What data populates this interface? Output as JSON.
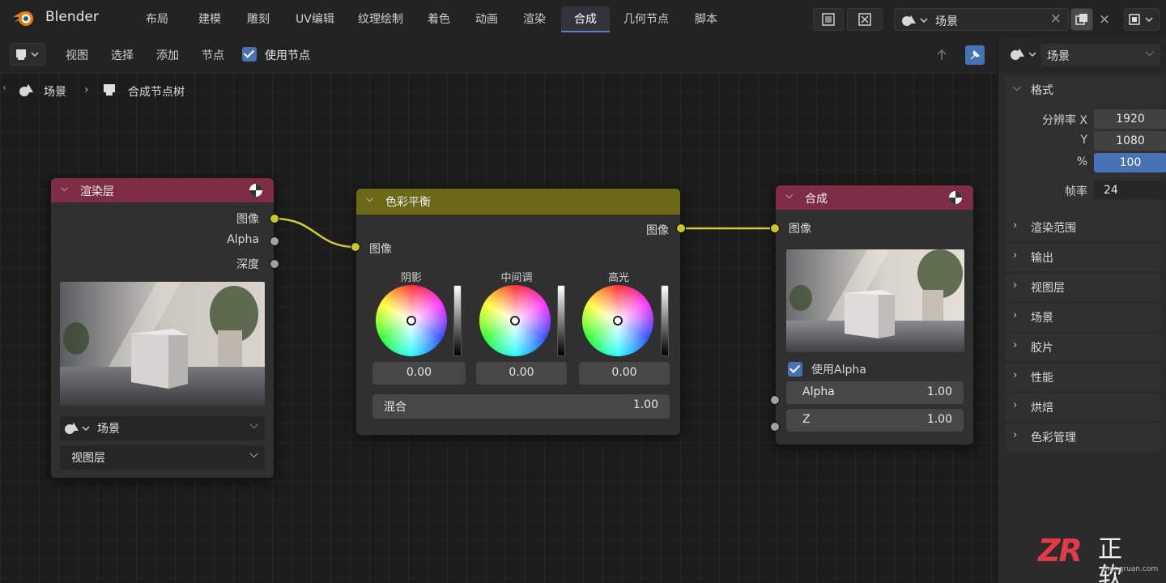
{
  "app": {
    "name": "Blender"
  },
  "workspaces": [
    "布局",
    "建模",
    "雕刻",
    "UV编辑",
    "纹理绘制",
    "着色",
    "动画",
    "渲染",
    "合成",
    "几何节点",
    "脚本"
  ],
  "active_workspace": "合成",
  "topbar": {
    "scene_name": "场景",
    "close_symbol": "×"
  },
  "editor_header": {
    "menus": [
      "视图",
      "选择",
      "添加",
      "节点"
    ],
    "use_nodes_label": "使用节点"
  },
  "breadcrumb": {
    "scene": "场景",
    "tree": "合成节点树"
  },
  "render_layers_node": {
    "title": "渲染层",
    "outputs": [
      "图像",
      "Alpha",
      "深度"
    ],
    "scene": "场景",
    "view_layer": "视图层"
  },
  "color_balance_node": {
    "title": "色彩平衡",
    "output": "图像",
    "input": "图像",
    "wheels": [
      {
        "label": "阴影",
        "value": "0.00"
      },
      {
        "label": "中间调",
        "value": "0.00"
      },
      {
        "label": "高光",
        "value": "0.00"
      }
    ],
    "mix_label": "混合",
    "mix_value": "1.00"
  },
  "composite_node": {
    "title": "合成",
    "input": "图像",
    "use_alpha_label": "使用Alpha",
    "alpha_label": "Alpha",
    "alpha_value": "1.00",
    "z_label": "Z",
    "z_value": "1.00"
  },
  "sidebar": {
    "scene_name": "场景",
    "format": {
      "title": "格式",
      "res_x_label": "分辨率 X",
      "res_x": "1920",
      "res_y_label": "Y",
      "res_y": "1080",
      "percent_label": "%",
      "percent": "100",
      "fps_label": "帧率",
      "fps": "24"
    },
    "panels": [
      "渲染范围",
      "输出",
      "视图层",
      "场景",
      "胶片",
      "性能",
      "烘焙",
      "色彩管理"
    ]
  },
  "watermark": {
    "logo_text": "ZR",
    "brand": "正软",
    "url": "zhengruan.com"
  },
  "colors": {
    "accent_blue": "#4772b3",
    "node_red": "#7e2d45",
    "node_olive": "#6b6917",
    "socket_yellow": "#c7c729",
    "link_yellow": "#d4cc3a"
  }
}
